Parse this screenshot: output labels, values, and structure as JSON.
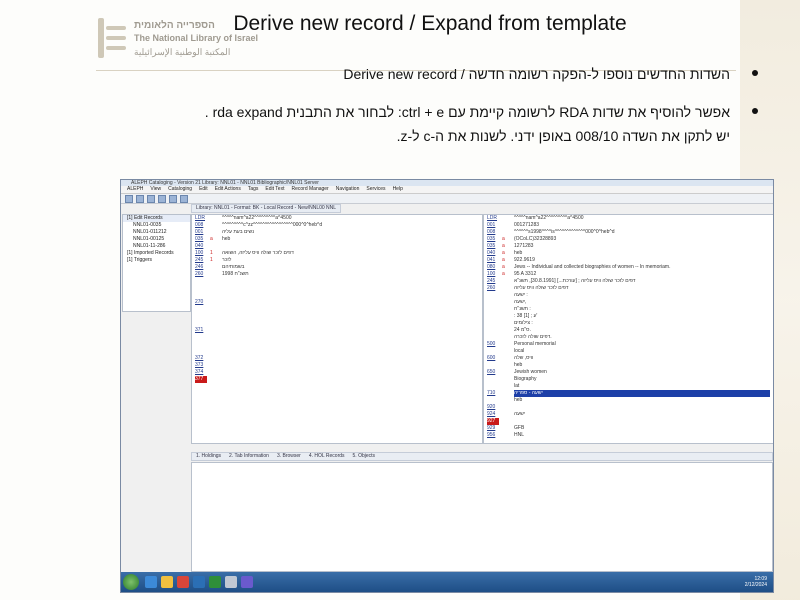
{
  "logo": {
    "hebrew": "הספרייה הלאומית",
    "english_line1": "The National Library of Israel",
    "arabic": "المكتبة الوطنية الإسرائيلية"
  },
  "slide": {
    "title": "Derive new record / Expand from template",
    "bullet1": "השדות החדשים נוספו ל-הפקה רשומה חדשה / Derive new record",
    "bullet2": "אפשר להוסיף את שדות RDA לרשומה קיימת עם ctrl + e: לבחור את התבנית rda expand .",
    "bullet3": "יש לתקן את השדה 008/10 באופן ידני. לשנות את ה-c ל-z."
  },
  "app": {
    "window_title": "ALEPH Cataloging - Version 21 Library: NNL01 - NNL01 Bibliographic/NNL01 Server",
    "menus": [
      "ALEPH",
      "View",
      "Cataloging",
      "Edit",
      "Edit Actions",
      "Tags",
      "Edit Text",
      "Record Manager",
      "Navigation",
      "Services",
      "Help"
    ],
    "tabs_label": "Library: NNL01 - Format: BK - Local Record - New/NNL00 NNL",
    "tree": [
      {
        "label": "[1] Edit Records",
        "indent": false
      },
      {
        "label": "NNL01-0035",
        "indent": true
      },
      {
        "label": "NNL01-011212",
        "indent": true
      },
      {
        "label": "NNL01-00125",
        "indent": true
      },
      {
        "label": "NNL01-11-286",
        "indent": true
      },
      {
        "label": "[1] Imported Records",
        "indent": false
      },
      {
        "label": "[1] Triggers",
        "indent": false
      }
    ],
    "left_record": [
      {
        "tag": "LDR",
        "ind": "",
        "val": "^^^^^nam^a22^^^^^^^^^a^4500"
      },
      {
        "tag": "008",
        "ind": "",
        "val": "^^^^^^^^^c^zz^^^^^^^^^^^^^^^^^000^0^heb^d"
      },
      {
        "tag": "001",
        "ind": "",
        "val": "נשים בעת עליה"
      },
      {
        "tag": "035",
        "ind": "a",
        "val": "heb"
      },
      {
        "tag": "040",
        "ind": "",
        "val": ""
      },
      {
        "tag": "100",
        "ind": "1",
        "val": "דפים לזכר שולה וויס עליזה, השואה"
      },
      {
        "tag": "245",
        "ind": "1",
        "val": "לזכר"
      },
      {
        "tag": "246",
        "ind": "",
        "val": "בשמותיהם"
      },
      {
        "tag": "260",
        "ind": "",
        "val": "1998 תשנ\"ח"
      },
      {
        "tag": "",
        "ind": "",
        "val": ""
      },
      {
        "tag": "",
        "ind": "",
        "val": ""
      },
      {
        "tag": "",
        "ind": "",
        "val": ""
      },
      {
        "tag": "270",
        "ind": "",
        "val": ""
      },
      {
        "tag": "",
        "ind": "",
        "val": ""
      },
      {
        "tag": "",
        "ind": "",
        "val": ""
      },
      {
        "tag": "",
        "ind": "",
        "val": ""
      },
      {
        "tag": "371",
        "ind": "",
        "val": ""
      },
      {
        "tag": "",
        "ind": "",
        "val": ""
      },
      {
        "tag": "",
        "ind": "",
        "val": ""
      },
      {
        "tag": "",
        "ind": "",
        "val": ""
      },
      {
        "tag": "372",
        "ind": "",
        "val": ""
      },
      {
        "tag": "373",
        "ind": "",
        "val": ""
      },
      {
        "tag": "374",
        "ind": "",
        "val": ""
      },
      {
        "tag": "377",
        "ind": "",
        "val": ""
      }
    ],
    "right_record": [
      {
        "tag": "LDR",
        "ind": "",
        "val": "^^^^^nam^a22^^^^^^^^^a^4500"
      },
      {
        "tag": "001",
        "ind": "",
        "val": "001271283"
      },
      {
        "tag": "008",
        "ind": "",
        "val": "^^^^^^s1998^^^^is^^^^^^^^^^^^^000^0^heb^d"
      },
      {
        "tag": "035",
        "ind": "a",
        "val": "(OCoLC)32328893"
      },
      {
        "tag": "035",
        "ind": "a",
        "val": "1271283"
      },
      {
        "tag": "040",
        "ind": "a",
        "val": "heb"
      },
      {
        "tag": "041",
        "ind": "a",
        "val": "922.9619"
      },
      {
        "tag": "080",
        "ind": "a",
        "val": "Jews -- Individual and collected biographies of women -- In memoriam."
      },
      {
        "tag": "100",
        "ind": "a",
        "val": "95 A 3312"
      },
      {
        "tag": "245",
        "ind": "",
        "val": "דפים לזכר שולה וויס עליזה ; [עורכת...] [30.8.1991], תשנ\"א"
      },
      {
        "tag": "260",
        "ind": "",
        "val": "דפים לזכר שולה וויס עליזה"
      },
      {
        "tag": "",
        "ind": "",
        "val": "ישעה :"
      },
      {
        "tag": "",
        "ind": "",
        "val": "ישעה,"
      },
      {
        "tag": "",
        "ind": "",
        "val": "תשנ\"ח :"
      },
      {
        "tag": "",
        "ind": "",
        "val": ": 38 [1] ; ע'"
      },
      {
        "tag": "",
        "ind": "",
        "val": "צילומים :"
      },
      {
        "tag": "",
        "ind": "",
        "val": "24 ס\"מ."
      },
      {
        "tag": "",
        "ind": "",
        "val": "דפים שולה לזכרה."
      },
      {
        "tag": "500",
        "ind": "",
        "val": "Personal memorial"
      },
      {
        "tag": "",
        "ind": "",
        "val": "local"
      },
      {
        "tag": "600",
        "ind": "",
        "val": "וויס, שלה"
      },
      {
        "tag": "",
        "ind": "",
        "val": "heb"
      },
      {
        "tag": "650",
        "ind": "",
        "val": "Jewish women"
      },
      {
        "tag": "",
        "ind": "",
        "val": "Biography"
      },
      {
        "tag": "",
        "ind": "",
        "val": "lat"
      },
      {
        "tag": "710",
        "ind": "",
        "val": "ישעה - ספריה"
      },
      {
        "tag": "",
        "ind": "",
        "val": "heb"
      },
      {
        "tag": "920",
        "ind": "",
        "val": ""
      },
      {
        "tag": "924",
        "ind": "",
        "val": "ישעה"
      },
      {
        "tag": "927",
        "ind": "",
        "val": ""
      },
      {
        "tag": "929",
        "ind": "",
        "val": "GFB"
      },
      {
        "tag": "956",
        "ind": "",
        "val": "HNL"
      }
    ],
    "bottom_tabs": [
      "1. Holdings",
      "2. Tab Information",
      "3. Browser",
      "4. HOL Records",
      "5. Objects"
    ],
    "clock_time": "12:09",
    "clock_date": "2/12/2024"
  },
  "colors": {
    "tag_link": "#223a8c",
    "indicator": "#cc2222",
    "highlight_tag": "#c91a1a",
    "highlight_value": "#1d3fa8"
  }
}
